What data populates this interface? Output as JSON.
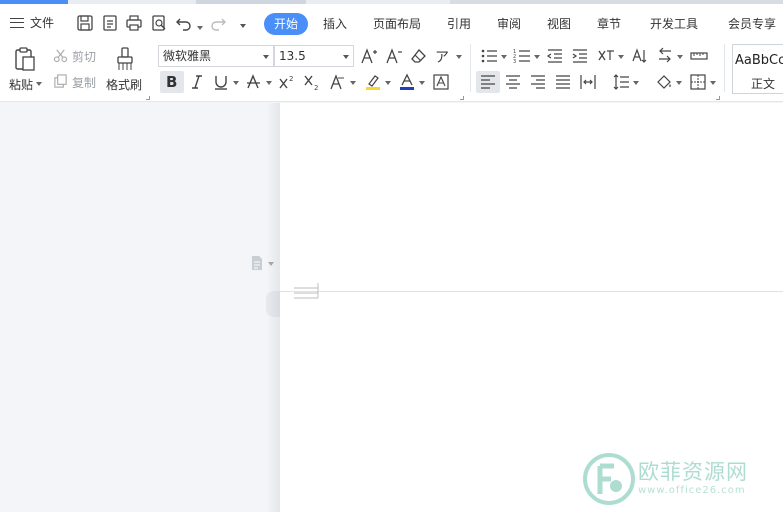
{
  "menubar": {
    "file_label": "文件",
    "tabs": [
      "开始",
      "插入",
      "页面布局",
      "引用",
      "审阅",
      "视图",
      "章节",
      "开发工具",
      "会员专享"
    ],
    "active_tab": "开始"
  },
  "ribbon": {
    "paste": "粘贴",
    "cut": "剪切",
    "copy": "复制",
    "format_painter": "格式刷",
    "font_name": "微软雅黑",
    "font_size": "13.5",
    "style_preview": "AaBbCc",
    "style_name": "正文"
  },
  "watermark": {
    "text": "欧菲资源网",
    "url": "www.office26.com"
  },
  "colors": {
    "accent": "#4a8ff7",
    "highlight": "#f6d92a",
    "font_color": "#1f3fbf",
    "watermark": "#9fd7c9"
  }
}
